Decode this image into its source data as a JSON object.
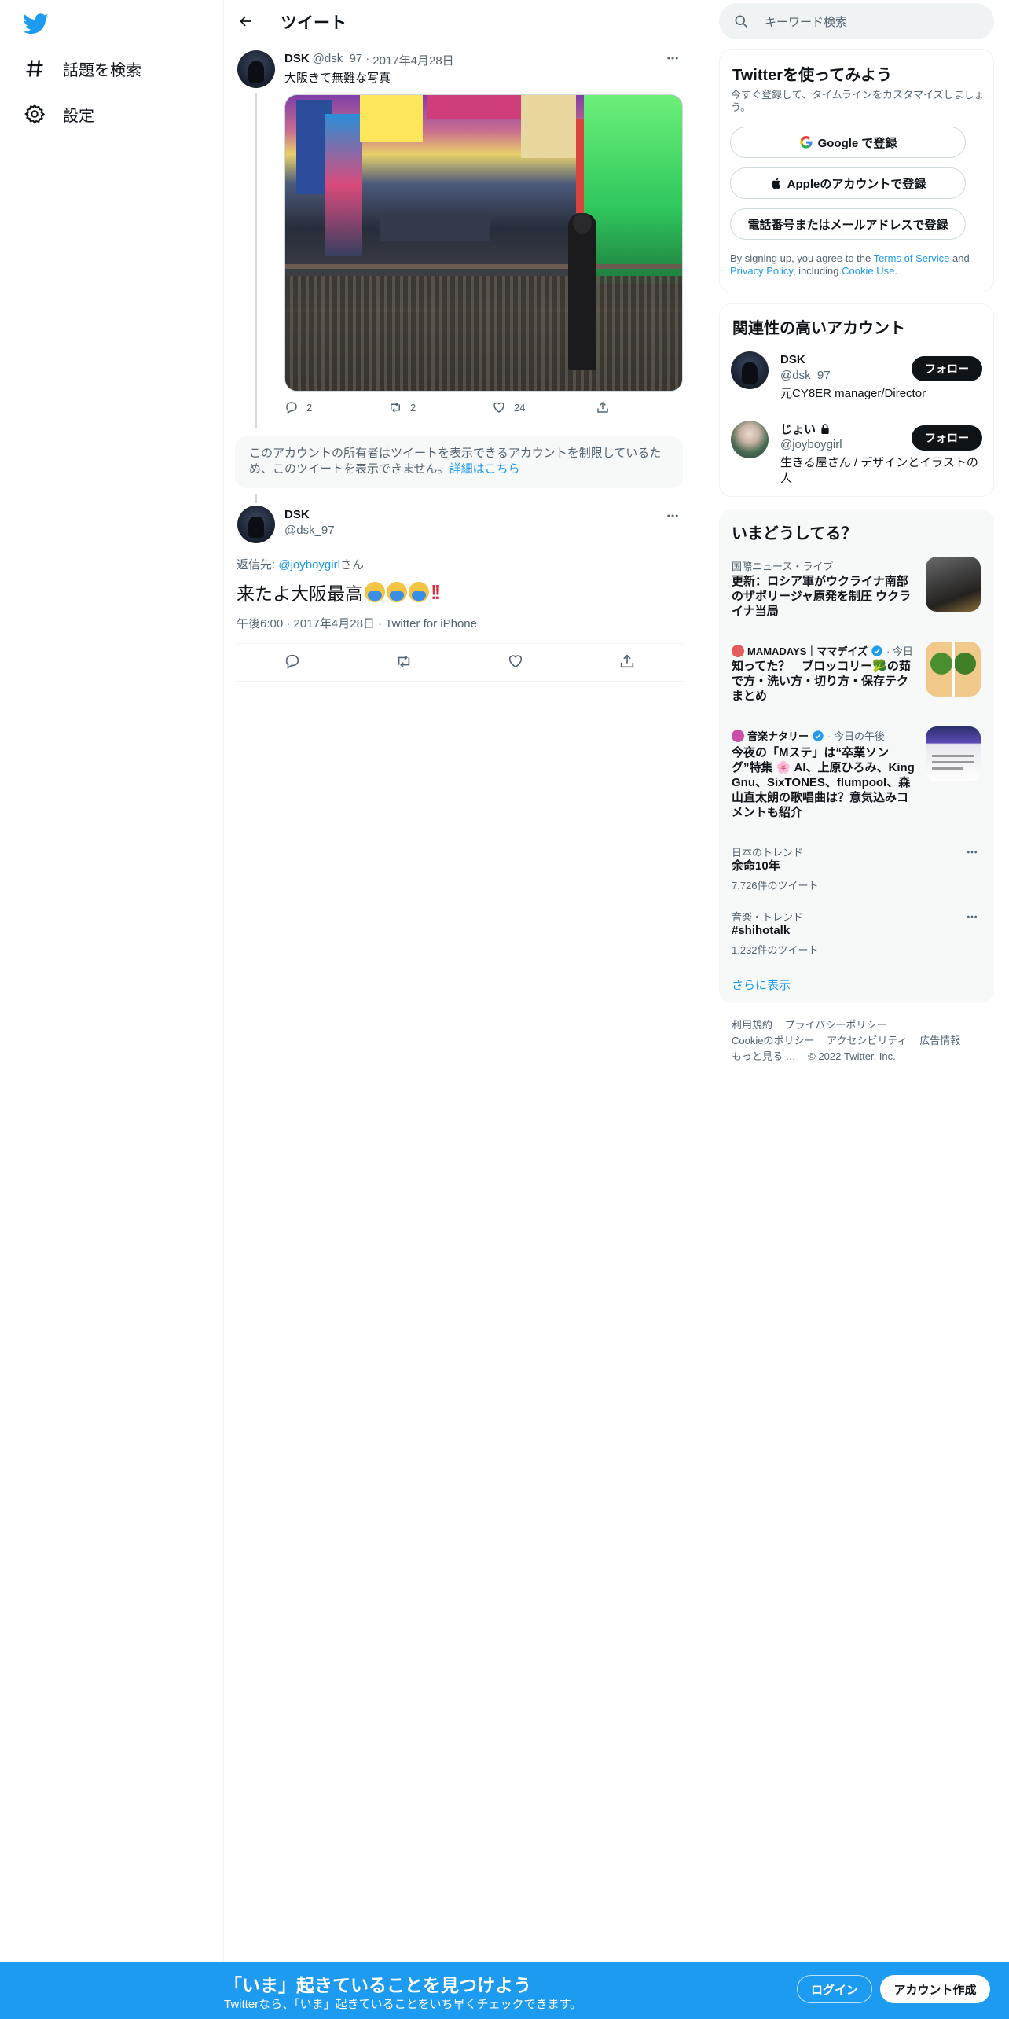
{
  "nav": {
    "items": [
      {
        "label": "話題を検索",
        "icon": "hashtag-icon"
      },
      {
        "label": "設定",
        "icon": "gear-icon"
      }
    ]
  },
  "header": {
    "title": "ツイート"
  },
  "tweet1": {
    "name": "DSK",
    "handle": "@dsk_97",
    "separator": "·",
    "date": "2017年4月28日",
    "text": "大阪きて無難な写真",
    "replies": "2",
    "retweets": "2",
    "likes": "24"
  },
  "notice": {
    "text": "このアカウントの所有者はツイートを表示できるアカウントを制限しているため、このツイートを表示できません。",
    "link": "詳細はこちら"
  },
  "tweet2": {
    "name": "DSK",
    "handle": "@dsk_97",
    "reply_prefix": "返信先: ",
    "reply_to": "@joyboygirl",
    "reply_suffix": "さん",
    "text": "来たよ大阪最高",
    "meta": "午後6:00 · 2017年4月28日 · Twitter for iPhone"
  },
  "search": {
    "placeholder": "キーワード検索"
  },
  "signup": {
    "title": "Twitterを使ってみよう",
    "desc": "今すぐ登録して、タイムラインをカスタマイズしましょう。",
    "google": "Google で登録",
    "apple": "Appleのアカウントで登録",
    "phone": "電話番号またはメールアドレスで登録",
    "legal_1": "By signing up, you agree to the ",
    "terms": "Terms of Service",
    "legal_2": " and ",
    "privacy": "Privacy Policy",
    "legal_3": ", including ",
    "cookie": "Cookie Use",
    "legal_4": "."
  },
  "related": {
    "title": "関連性の高いアカウント",
    "accounts": [
      {
        "name": "DSK",
        "handle": "@dsk_97",
        "bio": "元CY8ER manager/Director",
        "follow": "フォロー"
      },
      {
        "name": "じょい",
        "handle": "@joyboygirl",
        "bio": "生きる屋さん / デザインとイラストの人",
        "follow": "フォロー"
      }
    ]
  },
  "trends": {
    "title": "いまどうしてる？",
    "items": [
      {
        "meta": "国際ニュース・ライブ",
        "title": "更新：ロシア軍がウクライナ南部のザポリージャ原発を制圧 ウクライナ当局"
      },
      {
        "source": "MAMADAYS｜ママデイズ",
        "time": "· 今日",
        "title": "知ってた？　ブロッコリー🥦の茹で方・洗い方・切り方・保存テクまとめ"
      },
      {
        "source": "音楽ナタリー",
        "time": "· 今日の午後",
        "title": "今夜の「Mステ」は“卒業ソング”特集 🌸 AI、上原ひろみ、King Gnu、SixTONES、flumpool、森山直太朗の歌唱曲は？意気込みコメントも紹介"
      },
      {
        "meta": "日本のトレンド",
        "title": "余命10年",
        "count": "7,726件のツイート"
      },
      {
        "meta": "音楽・トレンド",
        "title": "#shihotalk",
        "count": "1,232件のツイート"
      }
    ],
    "show_more": "さらに表示"
  },
  "footer": {
    "links": [
      "利用規約",
      "プライバシーポリシー",
      "Cookieのポリシー",
      "アクセシビリティ",
      "広告情報",
      "もっと見る …",
      "© 2022 Twitter, Inc."
    ]
  },
  "bottombar": {
    "title": "「いま」起きていることを見つけよう",
    "subtitle": "Twitterなら、「いま」起きていることをいち早くチェックできます。",
    "login": "ログイン",
    "signup": "アカウント作成"
  },
  "colors": {
    "accent": "#1d9bf0",
    "text": "#0f1419",
    "muted": "#536471",
    "border": "#eff3f4"
  }
}
